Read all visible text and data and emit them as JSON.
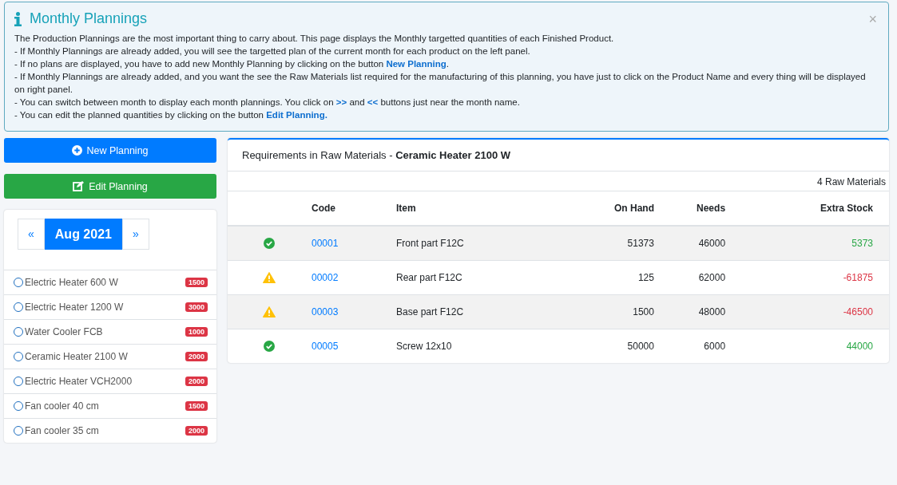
{
  "alert": {
    "title": "Monthly Plannings",
    "close": "×",
    "lines": [
      [
        {
          "kind": "text",
          "text": "The Production Plannings are the most important thing to carry about. This page displays the Monthly targetted quantities of each Finished Product."
        }
      ],
      [
        {
          "kind": "text",
          "text": "- If Monthly Plannings are already added, you will see the targetted plan of the current month for each product on the left panel."
        }
      ],
      [
        {
          "kind": "text",
          "text": "- If no plans are displayed, you have to add new Monthly Planning by clicking on the button "
        },
        {
          "kind": "link",
          "text": "New Planning"
        },
        {
          "kind": "text",
          "text": "."
        }
      ],
      [
        {
          "kind": "text",
          "text": "- If Monthly Plannings are already added, and you want the see the Raw Materials list required for the manufacturing of this planning, you have just to click on the Product Name and every thing will be displayed on right panel."
        }
      ],
      [
        {
          "kind": "text",
          "text": "- You can switch between month to display each month plannings. You click on "
        },
        {
          "kind": "link",
          "text": ">>"
        },
        {
          "kind": "text",
          "text": " and "
        },
        {
          "kind": "link",
          "text": "<<"
        },
        {
          "kind": "text",
          "text": " buttons just near the month name."
        }
      ],
      [
        {
          "kind": "text",
          "text": "- You can edit the planned quantities by clicking on the button "
        },
        {
          "kind": "link",
          "text": "Edit Planning."
        }
      ]
    ]
  },
  "buttons": [
    {
      "kind": "new",
      "label": "New Planning"
    },
    {
      "kind": "edit",
      "label": "Edit Planning"
    }
  ],
  "month": {
    "prev": "«",
    "label": "Aug 2021",
    "next": "»"
  },
  "products": [
    {
      "name": "Electric Heater 600 W",
      "count": "1500",
      "selected": false
    },
    {
      "name": "Electric Heater 1200 W",
      "count": "3000",
      "selected": false
    },
    {
      "name": "Water Cooler FCB",
      "count": "1000",
      "selected": false
    },
    {
      "name": "Ceramic Heater 2100 W",
      "count": "2000",
      "selected": false
    },
    {
      "name": "Electric Heater VCH2000",
      "count": "2000",
      "selected": false
    },
    {
      "name": "Fan cooler 40 cm",
      "count": "1500",
      "selected": false
    },
    {
      "name": "Fan cooler 35 cm",
      "count": "2000",
      "selected": false
    }
  ],
  "panel": {
    "title": "Requirements in Raw Materials - ",
    "product": "Ceramic Heater 2100 W",
    "count": "4 Raw Materials"
  },
  "table": {
    "columns": [
      "Code",
      "Item",
      "On Hand",
      "Needs",
      "Extra Stock"
    ],
    "rows": [
      {
        "kind": "ok",
        "code": "00001",
        "item": "Front part F12C",
        "on_hand": "51373",
        "needs": "46000",
        "extra": "5373"
      },
      {
        "kind": "warning",
        "code": "00002",
        "item": "Rear part F12C",
        "on_hand": "125",
        "needs": "62000",
        "extra": "-61875"
      },
      {
        "kind": "warning",
        "code": "00003",
        "item": "Base part F12C",
        "on_hand": "1500",
        "needs": "48000",
        "extra": "-46500"
      },
      {
        "kind": "ok",
        "code": "00005",
        "item": "Screw 12x10",
        "on_hand": "50000",
        "needs": "6000",
        "extra": "44000"
      }
    ]
  }
}
